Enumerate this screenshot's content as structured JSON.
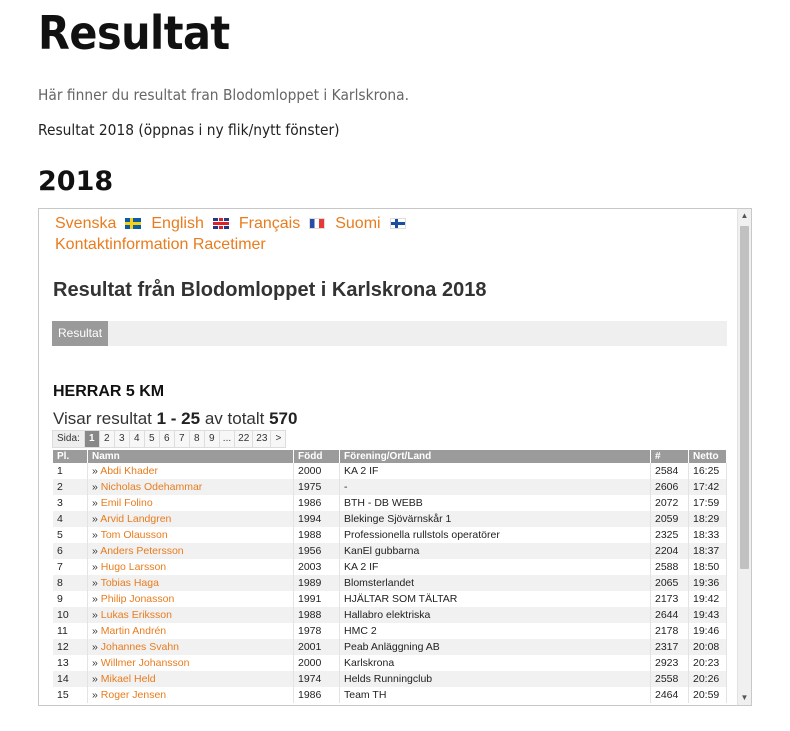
{
  "page": {
    "title": "Resultat",
    "intro": "Här finner du resultat fran Blodomloppet i Karlskrona.",
    "results_link": "Resultat 2018 (öppnas i ny flik/nytt fönster)",
    "year_heading": "2018"
  },
  "embed": {
    "languages": [
      {
        "label": "Svenska",
        "flag": "flag-se"
      },
      {
        "label": "English",
        "flag": "flag-uk"
      },
      {
        "label": "Français",
        "flag": "flag-fr"
      },
      {
        "label": "Suomi",
        "flag": "flag-fi"
      }
    ],
    "contact_link": "Kontaktinformation Racetimer",
    "heading": "Resultat från Blodomloppet i Karlskrona 2018",
    "tab_label": "Resultat",
    "category": "HERRAR 5 KM",
    "showing_prefix": "Visar resultat ",
    "showing_range": "1 - 25",
    "showing_mid": " av totalt ",
    "showing_total": "570",
    "pager": {
      "label": "Sida:",
      "pages": [
        "1",
        "2",
        "3",
        "4",
        "5",
        "6",
        "7",
        "8",
        "9",
        "...",
        "22",
        "23",
        ">"
      ],
      "active": "1"
    },
    "columns": [
      "Pl.",
      "Namn",
      "Född",
      "Förening/Ort/Land",
      "#",
      "Netto"
    ],
    "rows": [
      {
        "pl": "1",
        "name": "Abdi Khader",
        "born": "2000",
        "club": "KA 2 IF",
        "bib": "2584",
        "net": "16:25"
      },
      {
        "pl": "2",
        "name": "Nicholas Odehammar",
        "born": "1975",
        "club": "-",
        "bib": "2606",
        "net": "17:42"
      },
      {
        "pl": "3",
        "name": "Emil Folino",
        "born": "1986",
        "club": "BTH - DB WEBB",
        "bib": "2072",
        "net": "17:59"
      },
      {
        "pl": "4",
        "name": "Arvid Landgren",
        "born": "1994",
        "club": "Blekinge Sjövärnskår 1",
        "bib": "2059",
        "net": "18:29"
      },
      {
        "pl": "5",
        "name": "Tom Olausson",
        "born": "1988",
        "club": "Professionella rullstols operatörer",
        "bib": "2325",
        "net": "18:33"
      },
      {
        "pl": "6",
        "name": "Anders Petersson",
        "born": "1956",
        "club": "KanEl gubbarna",
        "bib": "2204",
        "net": "18:37"
      },
      {
        "pl": "7",
        "name": "Hugo Larsson",
        "born": "2003",
        "club": "KA 2 IF",
        "bib": "2588",
        "net": "18:50"
      },
      {
        "pl": "8",
        "name": "Tobias Haga",
        "born": "1989",
        "club": "Blomsterlandet",
        "bib": "2065",
        "net": "19:36"
      },
      {
        "pl": "9",
        "name": "Philip Jonasson",
        "born": "1991",
        "club": "HJÄLTAR SOM TÄLTAR",
        "bib": "2173",
        "net": "19:42"
      },
      {
        "pl": "10",
        "name": "Lukas Eriksson",
        "born": "1988",
        "club": "Hallabro elektriska",
        "bib": "2644",
        "net": "19:43"
      },
      {
        "pl": "11",
        "name": "Martin Andrén",
        "born": "1978",
        "club": "HMC 2",
        "bib": "2178",
        "net": "19:46"
      },
      {
        "pl": "12",
        "name": "Johannes Svahn",
        "born": "2001",
        "club": "Peab Anläggning AB",
        "bib": "2317",
        "net": "20:08"
      },
      {
        "pl": "13",
        "name": "Willmer Johansson",
        "born": "2000",
        "club": "Karlskrona",
        "bib": "2923",
        "net": "20:23"
      },
      {
        "pl": "14",
        "name": "Mikael Held",
        "born": "1974",
        "club": "Helds Runningclub",
        "bib": "2558",
        "net": "20:26"
      },
      {
        "pl": "15",
        "name": "Roger Jensen",
        "born": "1986",
        "club": "Team TH",
        "bib": "2464",
        "net": "20:59"
      }
    ],
    "colors": {
      "link": "#e87c1e",
      "header": "#9b9b9b"
    }
  }
}
